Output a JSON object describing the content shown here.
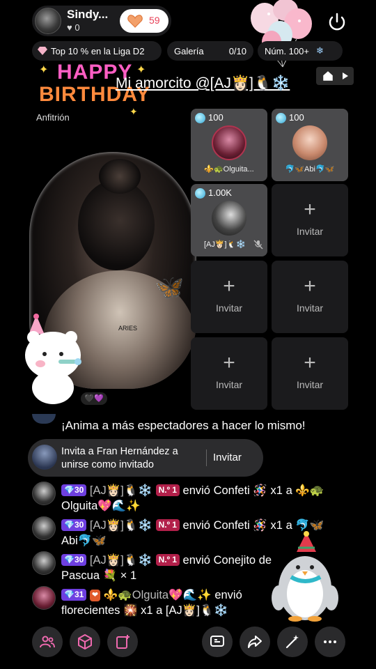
{
  "header": {
    "host_name": "Sindy...",
    "host_likes": "♥ 0",
    "follow_count": "59"
  },
  "chips": {
    "league": "Top 10 % en la Liga D2",
    "gallery_label": "Galería",
    "gallery_value": "0/10",
    "rank": "Núm. 100+"
  },
  "banner": {
    "happy": "HAPPY",
    "birthday": "BIRTHDAY",
    "host_role": "Anfitrión",
    "dedication": "Mi amorcito @[AJ👸🏻]🐧❄️"
  },
  "portrait": {
    "tattoo": "ARIES",
    "reactions": "🖤💜"
  },
  "guests": [
    {
      "coins": "100",
      "name": "⚜️🐢Olguita..."
    },
    {
      "coins": "100",
      "name": "🐬🦋Abi🐬🦋"
    },
    {
      "coins": "1.00K",
      "name": "[AJ👸🏻]🐧❄️"
    }
  ],
  "empty_slot": {
    "plus": "+",
    "label": "Invitar"
  },
  "chat": {
    "prompt": "¡Anima a más espectadores a hacer lo mismo!",
    "invite_text": "Invita a Fran Hernández a unirse como invitado",
    "invite_button": "Invitar",
    "messages": [
      {
        "level": "30",
        "user": "[AJ👸🏻]🐧❄️",
        "badge": "N.º 1",
        "text": " envió Confeti 🪅 x1 a ⚜️🐢Olguita💖🌊✨"
      },
      {
        "level": "30",
        "user": "[AJ👸🏻]🐧❄️",
        "badge": "N.º 1",
        "text": " envió Confeti 🪅 x1 a 🐬🦋Abi🐬🦋"
      },
      {
        "level": "30",
        "user": "[AJ👸🏻]🐧❄️",
        "badge": "N.º 1",
        "text": " envió Conejito de Pascua 💐 × 1"
      },
      {
        "level": "31",
        "user": "⚜️🐢Olguita💖🌊✨",
        "badge": "",
        "text": " envió florecientes 🎇 x1 a [AJ👸🏻]🐧❄️"
      }
    ]
  },
  "colors": {
    "accent_pink": "#e8435a",
    "level_purple": "#6e3fe0",
    "badge_red": "#b2204a"
  }
}
